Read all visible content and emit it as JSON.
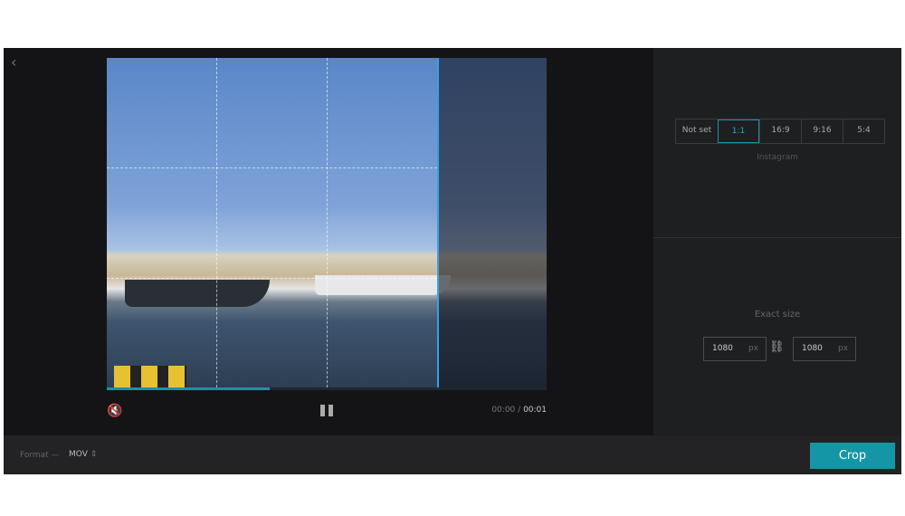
{
  "player": {
    "current_time": "00:00",
    "separator": "/",
    "duration": "00:01",
    "progress": 0.37,
    "back_icon": "chevron-left-icon",
    "mute_icon": "speaker-muted-icon",
    "pause_icon": "pause-icon"
  },
  "aspect": {
    "options": [
      "Not set",
      "1:1",
      "16:9",
      "9:16",
      "5:4"
    ],
    "selected": "1:1",
    "preset_label": "Instagram"
  },
  "size": {
    "title": "Exact size",
    "width": "1080",
    "height": "1080",
    "unit": "px",
    "link_icon": "chain-link-icon"
  },
  "footer": {
    "format_label": "Format —",
    "format_value": "MOV",
    "crop_label": "Crop"
  },
  "colors": {
    "accent": "#1596a6",
    "crop_border": "#3aa0e0"
  }
}
